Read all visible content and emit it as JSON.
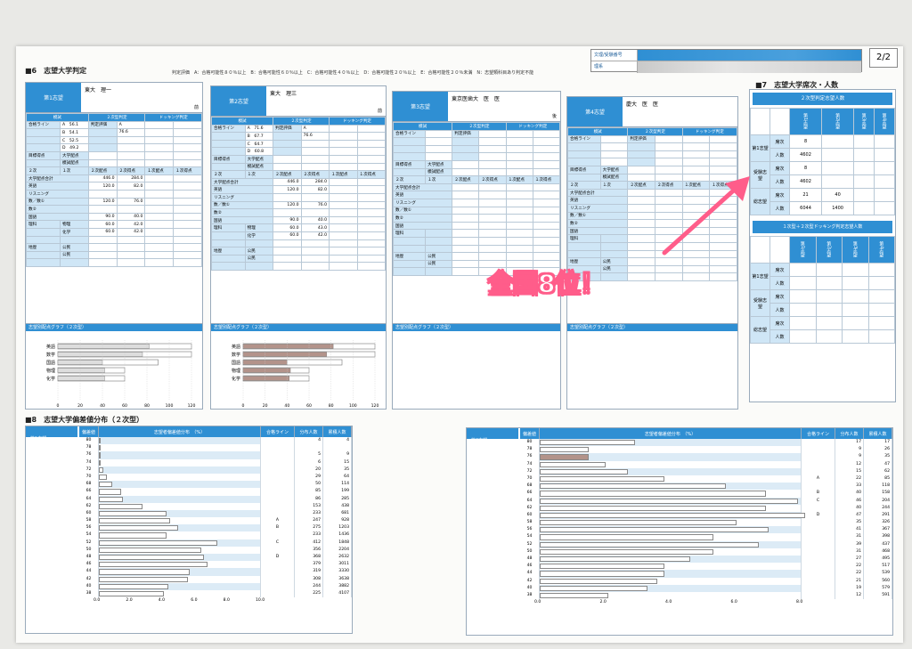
{
  "header": {
    "section6_title": "■6　志望大学判定",
    "legend": "判定評価　A：合格可能性８０％以上　B：合格可能性６０％以上　C：合格可能性４０％以上　D：合格可能性２０％以上　E：合格可能性２０％未満　N：志望類科目あり判定不能",
    "id_label": "文理/受験番号",
    "name_label": "理系",
    "page": "2/2"
  },
  "cards": [
    {
      "tag": "第1志望",
      "univ": "東大　理一",
      "ki": "前",
      "hyoka": "A",
      "score": "76.6",
      "lines": [
        "A　56.1",
        "B　54.1",
        "C　52.5",
        "D　49.2"
      ],
      "c1": "446.0",
      "c2": "284.0",
      "eng": "120.0",
      "eng2": "82.0",
      "math": "120.0",
      "math2": "76.0",
      "jp": "90.0",
      "jp2": "40.0",
      "sci1": "60.0",
      "sci1b": "42.0",
      "sci2": "60.0",
      "sci2b": "42.0",
      "sub1": "物理",
      "sub2": "化学"
    },
    {
      "tag": "第2志望",
      "univ": "東大　理三",
      "ki": "前",
      "hyoka": "A",
      "score": "76.6",
      "lines": [
        "A　71.6",
        "B　67.7",
        "C　64.7",
        "D　60.8"
      ],
      "c1": "446.0",
      "c2": "284.0",
      "eng": "120.0",
      "eng2": "82.0",
      "math": "120.0",
      "math2": "76.0",
      "jp": "90.0",
      "jp2": "40.0",
      "sci1": "60.0",
      "sci1b": "43.0",
      "sci2": "60.0",
      "sci2b": "42.0",
      "sub1": "物理",
      "sub2": "化学"
    },
    {
      "tag": "第3志望",
      "univ": "東京医歯大　医　医",
      "ki": "後"
    },
    {
      "tag": "第4志望",
      "univ": "慶大　医　医",
      "ki": ""
    }
  ],
  "labels": {
    "moshi": "模試",
    "niji": "２次型判定\n（今回）",
    "dock": "ドッキング判定\n（１次型＋２次型）",
    "gokaku": "合格ライン",
    "hantei": "判定評価",
    "mokuhyo": "目標得点",
    "daigaku": "大学配点",
    "moshi_haiten": "模試配点",
    "ichiji_h": "１次配点",
    "ichiji_t": "１次得点",
    "niji_h": "２次配点",
    "niji_t": "２次得点",
    "total": "大学配点合計",
    "eng": "英語",
    "listen": "リスニング",
    "math": "数／数①",
    "math2": "数②",
    "jp": "国語",
    "sci": "理科",
    "soc": "地歴公民",
    "graph": "志望別配点グラフ（２次型）",
    "ichiji": "１次",
    "niji2": "２次",
    "rigaku": "理科",
    "chireki": "地歴",
    "komin": "公民"
  },
  "section7": {
    "title": "■7　志望大学席次・人数",
    "sub1": "２次型判定志望人数",
    "sub2": "１次型＋２次型ドッキング判定志望人数",
    "cols": [
      "第1志望",
      "第2志望",
      "第3志望",
      "第4志望"
    ],
    "rows": [
      {
        "group": "第1志望",
        "k": "席次",
        "v": [
          "8",
          "",
          "",
          ""
        ]
      },
      {
        "group": "",
        "k": "人数",
        "v": [
          "4602",
          "",
          "",
          ""
        ]
      },
      {
        "group": "受験志望",
        "k": "席次",
        "v": [
          "8",
          "",
          "",
          ""
        ]
      },
      {
        "group": "",
        "k": "人数",
        "v": [
          "4602",
          "",
          "",
          ""
        ]
      },
      {
        "group": "総志望",
        "k": "席次",
        "v": [
          "21",
          "40",
          "",
          ""
        ]
      },
      {
        "group": "",
        "k": "人数",
        "v": [
          "6044",
          "1400",
          "",
          ""
        ]
      }
    ],
    "rows2": [
      {
        "group": "第1志望",
        "k": "席次"
      },
      {
        "group": "",
        "k": "人数"
      },
      {
        "group": "受験志望",
        "k": "席次"
      },
      {
        "group": "",
        "k": "人数"
      },
      {
        "group": "総志望",
        "k": "席次"
      },
      {
        "group": "",
        "k": "人数"
      }
    ]
  },
  "callout": "全国8位！",
  "section8": {
    "title": "■8　志望大学偏差値分布（２次型）",
    "h_level": "偏差値",
    "h_dist": "志望者偏差値分布　（%）",
    "h_line": "合格ライン",
    "h_n": "分布人数",
    "h_cum": "累積人数",
    "left": {
      "tag": "第1志望",
      "axis": [
        "0.0",
        "2.0",
        "4.0",
        "6.0",
        "8.0",
        "10.0"
      ],
      "rows": [
        {
          "lv": "80",
          "pct": 0.0,
          "line": "",
          "n": "4",
          "c": "4"
        },
        {
          "lv": "78",
          "pct": 0.0,
          "line": "",
          "n": "",
          "c": ""
        },
        {
          "lv": "76",
          "pct": 0.1,
          "line": "",
          "n": "5",
          "c": "9",
          "me": true
        },
        {
          "lv": "74",
          "pct": 0.1,
          "line": "",
          "n": "6",
          "c": "15"
        },
        {
          "lv": "72",
          "pct": 0.3,
          "line": "",
          "n": "20",
          "c": "35"
        },
        {
          "lv": "70",
          "pct": 0.5,
          "line": "",
          "n": "29",
          "c": "64"
        },
        {
          "lv": "68",
          "pct": 0.8,
          "line": "",
          "n": "50",
          "c": "114"
        },
        {
          "lv": "66",
          "pct": 1.4,
          "line": "",
          "n": "85",
          "c": "199"
        },
        {
          "lv": "64",
          "pct": 1.5,
          "line": "",
          "n": "86",
          "c": "285"
        },
        {
          "lv": "62",
          "pct": 2.7,
          "line": "",
          "n": "153",
          "c": "438"
        },
        {
          "lv": "60",
          "pct": 4.2,
          "line": "",
          "n": "233",
          "c": "681"
        },
        {
          "lv": "58",
          "pct": 4.4,
          "line": "A",
          "n": "247",
          "c": "928"
        },
        {
          "lv": "56",
          "pct": 4.9,
          "line": "B",
          "n": "275",
          "c": "1203"
        },
        {
          "lv": "54",
          "pct": 4.2,
          "line": "",
          "n": "233",
          "c": "1436"
        },
        {
          "lv": "52",
          "pct": 7.3,
          "line": "C",
          "n": "412",
          "c": "1848"
        },
        {
          "lv": "50",
          "pct": 6.3,
          "line": "",
          "n": "356",
          "c": "2204"
        },
        {
          "lv": "48",
          "pct": 6.5,
          "line": "D",
          "n": "368",
          "c": "2632"
        },
        {
          "lv": "46",
          "pct": 6.7,
          "line": "",
          "n": "379",
          "c": "3011"
        },
        {
          "lv": "44",
          "pct": 5.6,
          "line": "",
          "n": "319",
          "c": "3330"
        },
        {
          "lv": "42",
          "pct": 5.5,
          "line": "",
          "n": "308",
          "c": "3638"
        },
        {
          "lv": "40",
          "pct": 4.3,
          "line": "",
          "n": "244",
          "c": "3882"
        },
        {
          "lv": "38",
          "pct": 4.0,
          "line": "",
          "n": "225",
          "c": "4107"
        }
      ]
    },
    "right": {
      "tag": "第2志望",
      "axis": [
        "0.0",
        "2.0",
        "4.0",
        "6.0",
        "8.0"
      ],
      "rows": [
        {
          "lv": "80",
          "pct": 2.9,
          "line": "",
          "n": "17",
          "c": "17"
        },
        {
          "lv": "78",
          "pct": 1.5,
          "line": "",
          "n": "9",
          "c": "26"
        },
        {
          "lv": "76",
          "pct": 1.5,
          "line": "",
          "n": "9",
          "c": "35",
          "me": true
        },
        {
          "lv": "74",
          "pct": 2.0,
          "line": "",
          "n": "12",
          "c": "47"
        },
        {
          "lv": "72",
          "pct": 2.7,
          "line": "",
          "n": "15",
          "c": "62"
        },
        {
          "lv": "70",
          "pct": 3.8,
          "line": "A",
          "n": "22",
          "c": "85"
        },
        {
          "lv": "68",
          "pct": 5.7,
          "line": "",
          "n": "33",
          "c": "118"
        },
        {
          "lv": "66",
          "pct": 6.9,
          "line": "B",
          "n": "40",
          "c": "158"
        },
        {
          "lv": "64",
          "pct": 7.9,
          "line": "C",
          "n": "46",
          "c": "204"
        },
        {
          "lv": "62",
          "pct": 6.9,
          "line": "",
          "n": "40",
          "c": "244"
        },
        {
          "lv": "60",
          "pct": 8.1,
          "line": "D",
          "n": "47",
          "c": "291"
        },
        {
          "lv": "58",
          "pct": 6.0,
          "line": "",
          "n": "35",
          "c": "326"
        },
        {
          "lv": "56",
          "pct": 7.0,
          "line": "",
          "n": "41",
          "c": "367"
        },
        {
          "lv": "54",
          "pct": 5.3,
          "line": "",
          "n": "31",
          "c": "398"
        },
        {
          "lv": "52",
          "pct": 6.7,
          "line": "",
          "n": "39",
          "c": "437"
        },
        {
          "lv": "50",
          "pct": 5.3,
          "line": "",
          "n": "31",
          "c": "468"
        },
        {
          "lv": "48",
          "pct": 4.6,
          "line": "",
          "n": "27",
          "c": "495"
        },
        {
          "lv": "46",
          "pct": 3.8,
          "line": "",
          "n": "22",
          "c": "517"
        },
        {
          "lv": "44",
          "pct": 3.8,
          "line": "",
          "n": "22",
          "c": "539"
        },
        {
          "lv": "42",
          "pct": 3.6,
          "line": "",
          "n": "21",
          "c": "560"
        },
        {
          "lv": "40",
          "pct": 3.3,
          "line": "",
          "n": "19",
          "c": "579"
        },
        {
          "lv": "38",
          "pct": 2.1,
          "line": "",
          "n": "12",
          "c": "591"
        }
      ]
    }
  },
  "graph": {
    "axis": [
      "0",
      "20",
      "40",
      "60",
      "80",
      "100",
      "120"
    ],
    "subjects": [
      "英語",
      "数学",
      "国語",
      "物理",
      "化学"
    ],
    "card1": [
      {
        "t": 82,
        "m": 120
      },
      {
        "t": 76,
        "m": 120
      },
      {
        "t": 40,
        "m": 90
      },
      {
        "t": 42,
        "m": 60
      },
      {
        "t": 42,
        "m": 60
      }
    ],
    "card2": [
      {
        "t": 82,
        "m": 120
      },
      {
        "t": 76,
        "m": 120
      },
      {
        "t": 40,
        "m": 90
      },
      {
        "t": 43,
        "m": 60
      },
      {
        "t": 42,
        "m": 60
      }
    ]
  }
}
